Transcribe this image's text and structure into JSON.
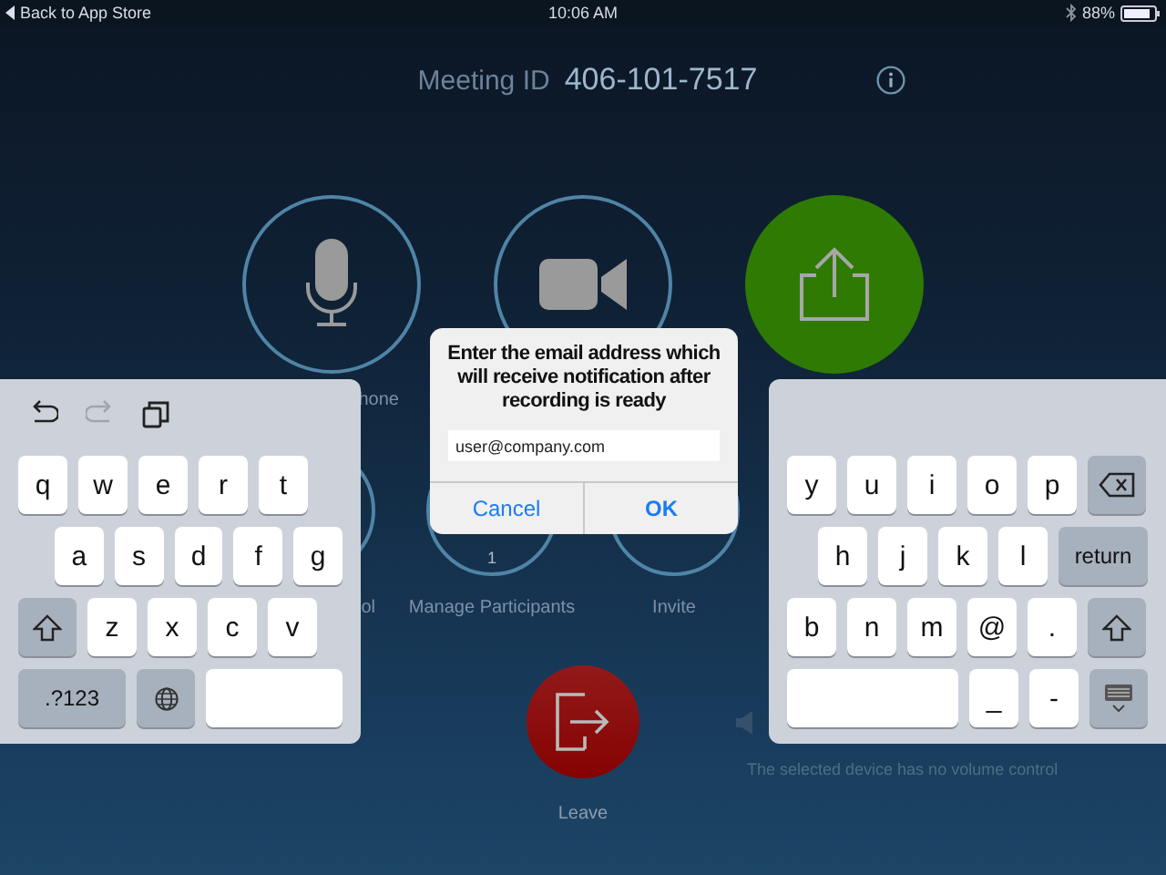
{
  "status_bar": {
    "back_label": "Back to App Store",
    "time": "10:06 AM",
    "battery": "88%"
  },
  "meeting": {
    "id_label": "Meeting ID",
    "id": "406-101-7517"
  },
  "main_controls": [
    {
      "kind": "mic",
      "label": "hone"
    },
    {
      "kind": "camera"
    },
    {
      "kind": "share"
    }
  ],
  "secondary_controls": [
    {
      "label": "ol"
    },
    {
      "label": "Manage Participants",
      "count": "1"
    },
    {
      "label": "Invite"
    }
  ],
  "leave": {
    "label": "Leave"
  },
  "volume": {
    "message": "The selected device has no volume control"
  },
  "dialog": {
    "title": "Enter the email address which will receive notification after recording is ready",
    "value": "user@company.com",
    "buttons": [
      "Cancel",
      "OK"
    ]
  },
  "keyboard_left": {
    "toolbar": [
      {
        "kind": "undo",
        "disabled": false
      },
      {
        "kind": "redo",
        "disabled": true
      },
      {
        "kind": "paste",
        "disabled": false
      }
    ],
    "rows": [
      {
        "keys": [
          {
            "kind": "char",
            "label": "q"
          },
          {
            "kind": "char",
            "label": "w"
          },
          {
            "kind": "char",
            "label": "e"
          },
          {
            "kind": "char",
            "label": "r"
          },
          {
            "kind": "char",
            "label": "t"
          }
        ]
      },
      {
        "keys": [
          {
            "kind": "char",
            "label": "a"
          },
          {
            "kind": "char",
            "label": "s"
          },
          {
            "kind": "char",
            "label": "d"
          },
          {
            "kind": "char",
            "label": "f"
          },
          {
            "kind": "char",
            "label": "g"
          }
        ]
      },
      {
        "keys": [
          {
            "kind": "shift"
          },
          {
            "kind": "char",
            "label": "z"
          },
          {
            "kind": "char",
            "label": "x"
          },
          {
            "kind": "char",
            "label": "c"
          },
          {
            "kind": "char",
            "label": "v"
          }
        ]
      },
      {
        "keys": [
          {
            "kind": "func",
            "label": ".?123"
          },
          {
            "kind": "globe"
          },
          {
            "kind": "space"
          }
        ]
      }
    ]
  },
  "keyboard_right": {
    "rows": [
      {
        "keys": [
          {
            "kind": "char",
            "label": "y"
          },
          {
            "kind": "char",
            "label": "u"
          },
          {
            "kind": "char",
            "label": "i"
          },
          {
            "kind": "char",
            "label": "o"
          },
          {
            "kind": "char",
            "label": "p"
          },
          {
            "kind": "delete"
          }
        ]
      },
      {
        "keys": [
          {
            "kind": "char",
            "label": "h"
          },
          {
            "kind": "char",
            "label": "j"
          },
          {
            "kind": "char",
            "label": "k"
          },
          {
            "kind": "char",
            "label": "l"
          },
          {
            "kind": "func",
            "label": "return"
          }
        ]
      },
      {
        "keys": [
          {
            "kind": "char",
            "label": "b"
          },
          {
            "kind": "char",
            "label": "n"
          },
          {
            "kind": "char",
            "label": "m"
          },
          {
            "kind": "char",
            "label": "@"
          },
          {
            "kind": "char",
            "label": "."
          },
          {
            "kind": "shift"
          }
        ]
      },
      {
        "keys": [
          {
            "kind": "space"
          },
          {
            "kind": "char",
            "label": "_"
          },
          {
            "kind": "char",
            "label": "-"
          },
          {
            "kind": "dismiss"
          }
        ]
      }
    ]
  }
}
